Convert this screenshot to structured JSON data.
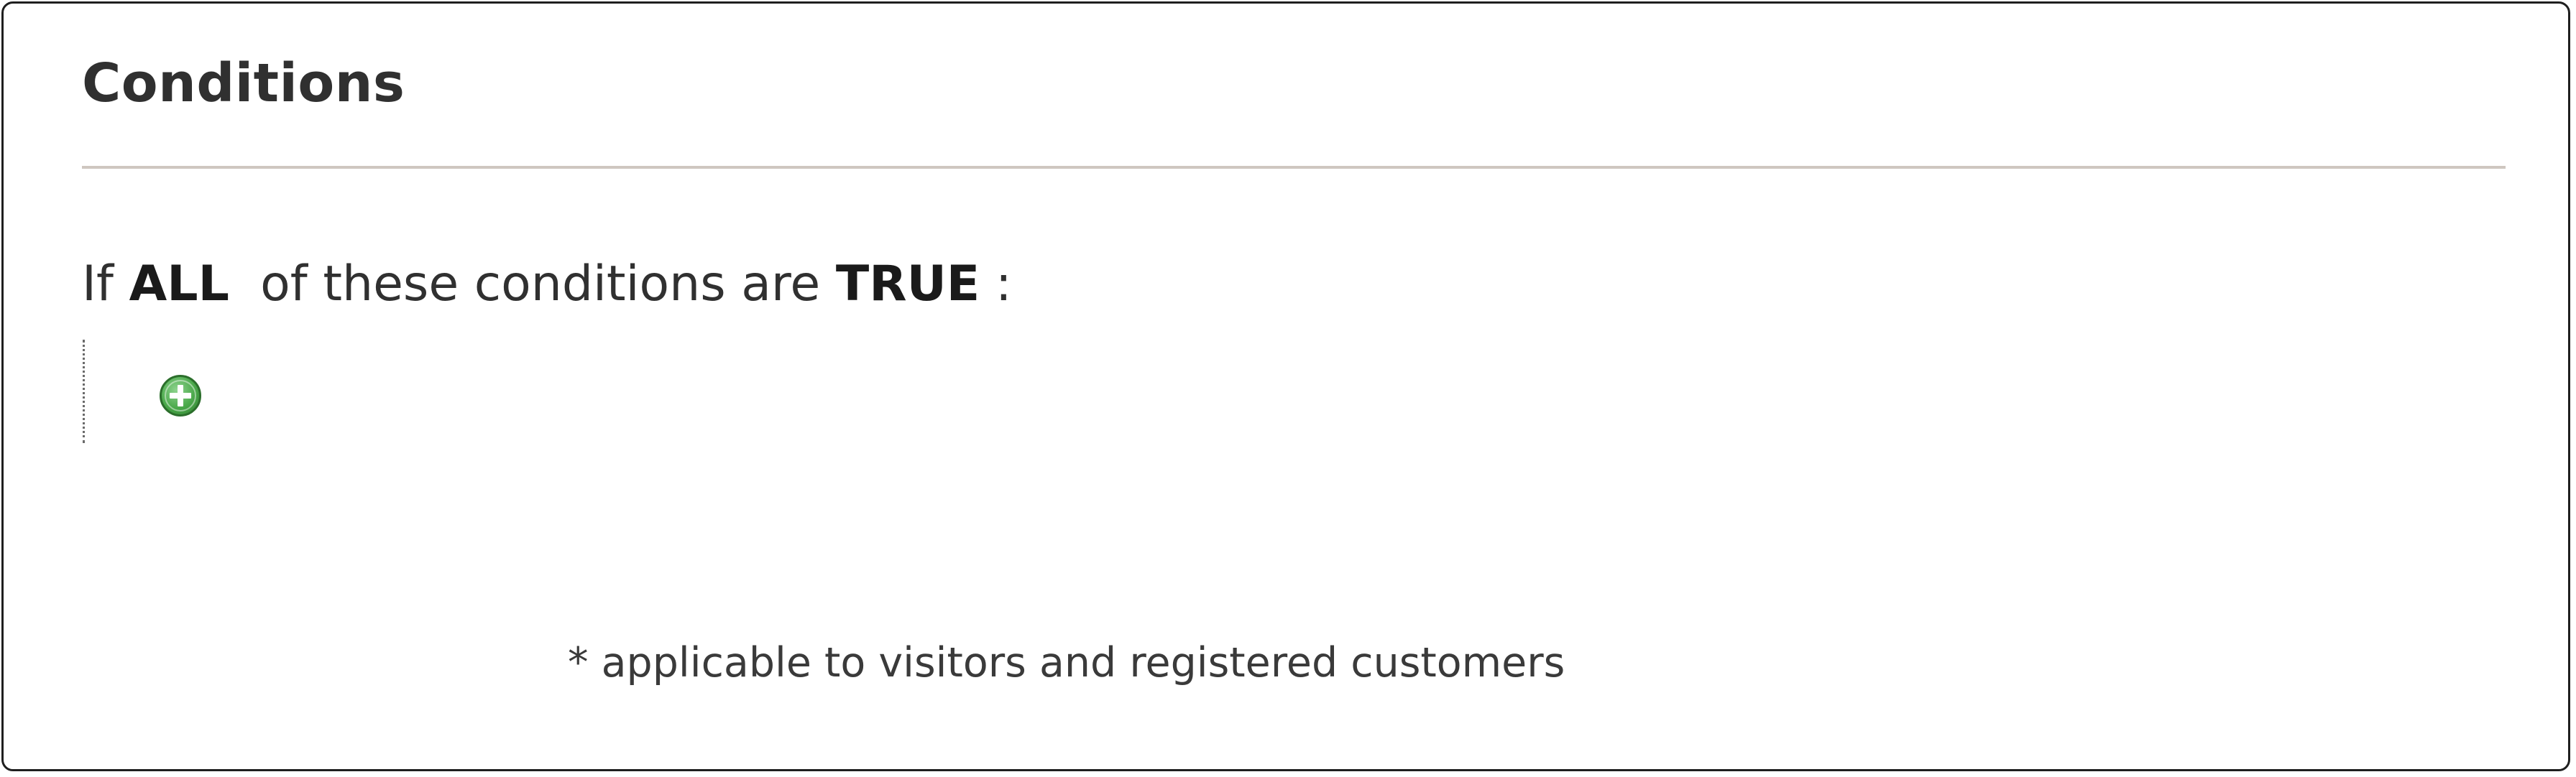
{
  "section": {
    "title": "Conditions"
  },
  "condition": {
    "prefix": "If",
    "aggregator": "ALL",
    "middle": "of these conditions are",
    "value": "TRUE",
    "suffix": ":"
  },
  "tree": {
    "add_icon": "add-circle-icon",
    "add_icon_color": "#4aa84a"
  },
  "footnote": "* applicable to visitors and registered customers"
}
